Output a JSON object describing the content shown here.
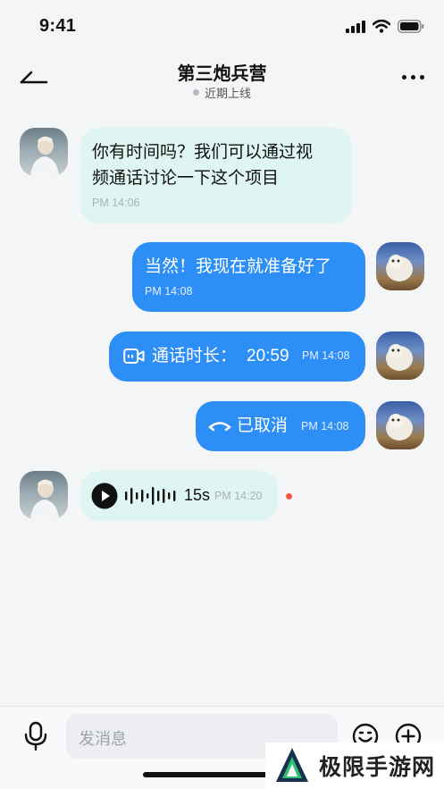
{
  "status_bar": {
    "time": "9:41"
  },
  "header": {
    "title": "第三炮兵营",
    "presence": "近期上线"
  },
  "messages": [
    {
      "text_line1": "你有时间吗？我们可以通过视",
      "text_line2": "频通话讨论一下这个项目",
      "time": "PM 14:06"
    },
    {
      "text": "当然！我现在就准备好了",
      "time": "PM 14:08"
    },
    {
      "label": "通话时长：",
      "duration": "20:59",
      "time": "PM 14:08"
    },
    {
      "text": "已取消",
      "time": "PM 14:08"
    },
    {
      "duration": "15s",
      "time": "PM 14:20"
    }
  ],
  "input": {
    "placeholder": "发消息"
  },
  "watermark": {
    "text": "极限手游网"
  },
  "colors": {
    "accent": "#2d8ff6",
    "incoming_bubble": "#dff5f2",
    "unread": "#f35a45"
  },
  "icons": [
    "signal-icon",
    "wifi-icon",
    "battery-icon",
    "back-arrow-icon",
    "more-icon",
    "video-call-icon",
    "hangup-icon",
    "play-icon",
    "waveform-icon",
    "mic-icon",
    "emoji-icon",
    "plus-icon"
  ]
}
